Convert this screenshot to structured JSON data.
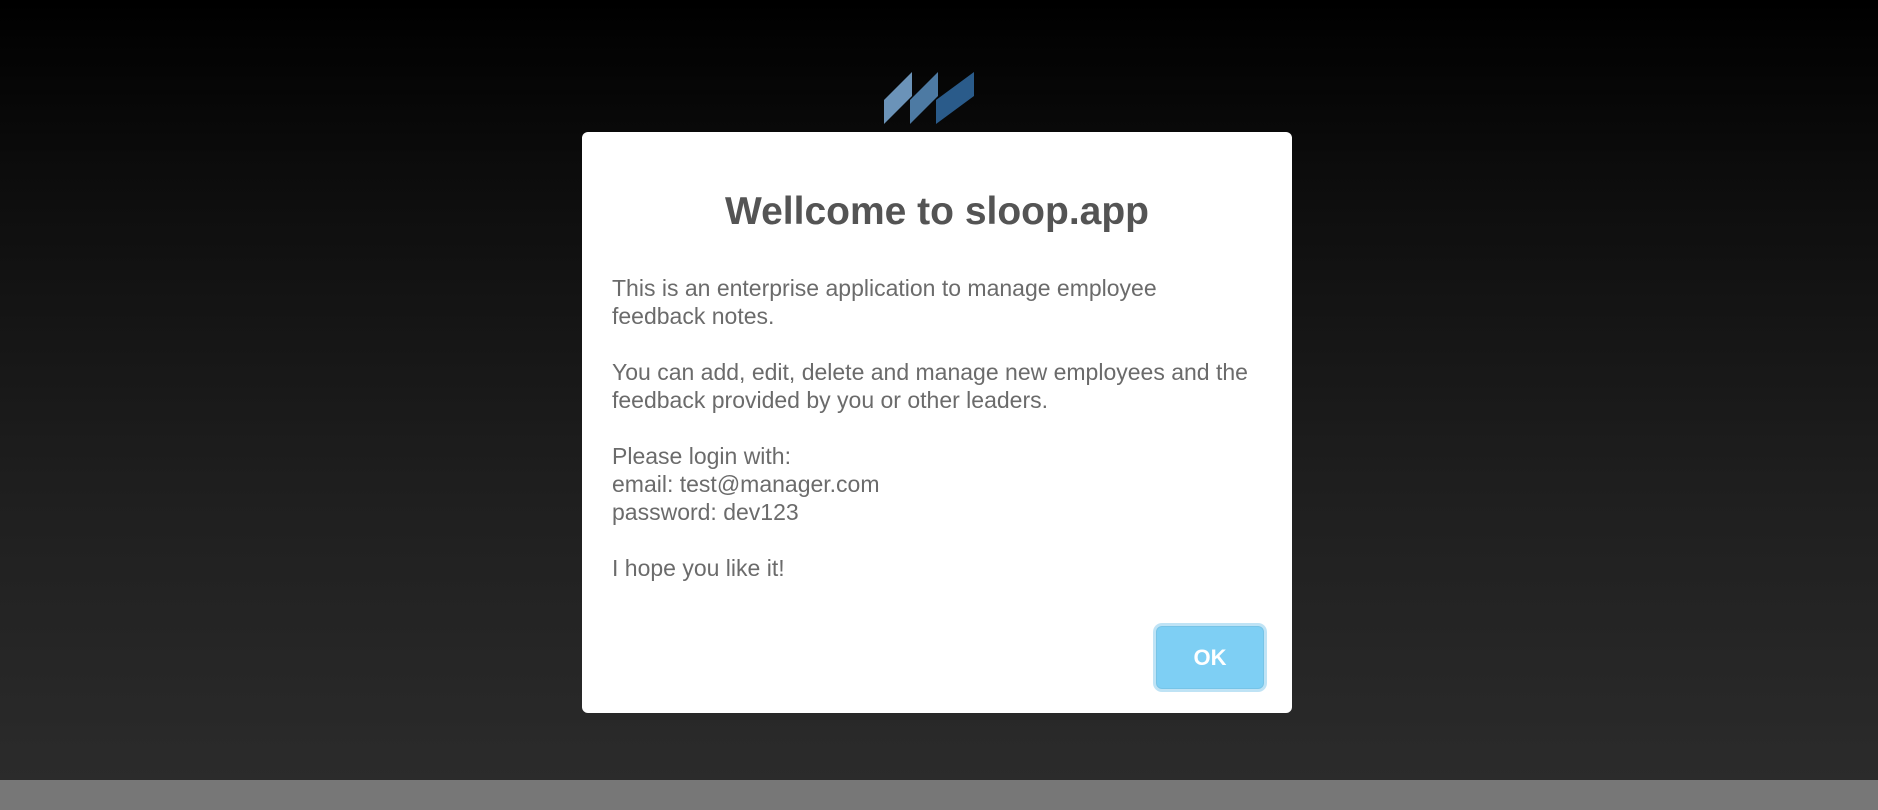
{
  "modal": {
    "title": "Wellcome to sloop.app",
    "paragraph1": "This is an enterprise application to manage employee feedback notes.",
    "paragraph2": "You can add, edit, delete and manage new employees and the feedback provided by you or other leaders.",
    "login_intro": "Please login with:",
    "email_line": "email: test@manager.com",
    "password_line": "password: dev123",
    "closing": "I hope you like it!",
    "ok_label": "OK"
  },
  "colors": {
    "logo_light": "#5a86ad",
    "logo_dark": "#2c5f8e",
    "ok_button": "#7ecff4",
    "title_text": "#545454",
    "body_text": "#6b6b6b"
  },
  "icons": {
    "logo": "sloop-logo-icon"
  }
}
